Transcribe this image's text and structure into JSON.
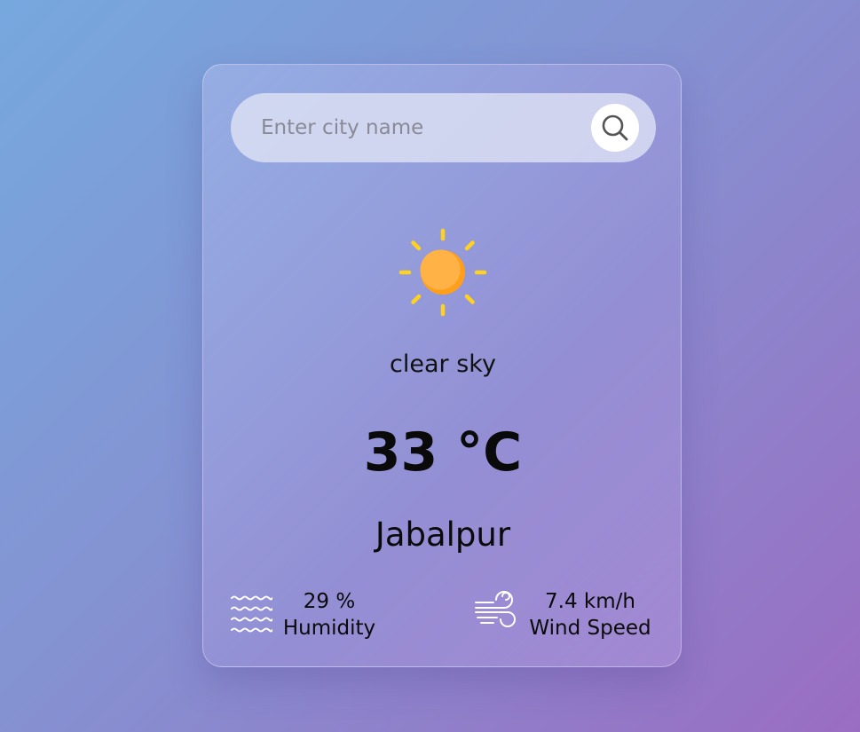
{
  "search": {
    "placeholder": "Enter city name",
    "value": ""
  },
  "weather": {
    "icon": "sun-icon",
    "description": "clear sky",
    "temperature": "33 °C",
    "city": "Jabalpur"
  },
  "stats": {
    "humidity": {
      "icon": "humidity-waves-icon",
      "value": "29 %",
      "label": "Humidity"
    },
    "wind": {
      "icon": "wind-icon",
      "value": "7.4 km/h",
      "label": "Wind Speed"
    }
  },
  "colors": {
    "sun_core": "#FFAB3D",
    "sun_rays": "#FFD21F",
    "text": "#0A0A0A"
  }
}
